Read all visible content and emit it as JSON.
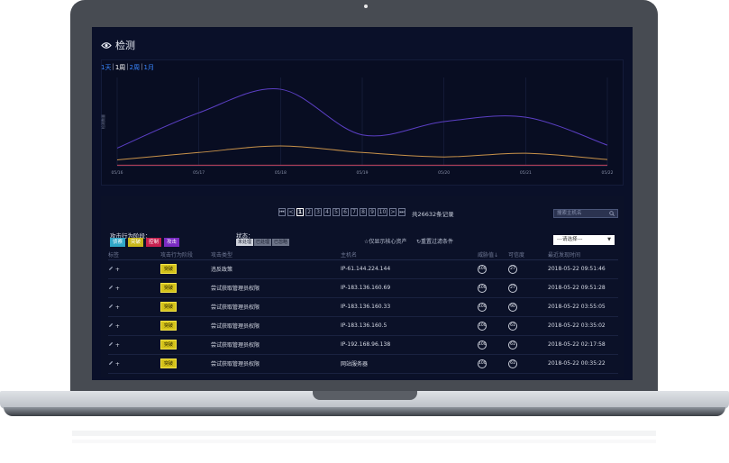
{
  "page": {
    "title": "检测",
    "title_icon": "eye-icon"
  },
  "range_tabs": [
    {
      "label": "1天",
      "active": false
    },
    {
      "label": "1周",
      "active": true
    },
    {
      "label": "2周",
      "active": false
    },
    {
      "label": "1月",
      "active": false
    }
  ],
  "chart_data": {
    "type": "line",
    "x": [
      "05/16",
      "05/17",
      "05/18",
      "05/19",
      "05/20",
      "05/21",
      "05/22"
    ],
    "ylabel": "检测数量",
    "series": [
      {
        "color": "#5b3fc4",
        "values": [
          1200,
          3600,
          5200,
          2100,
          3000,
          3300,
          1400
        ]
      },
      {
        "color": "#c8924a",
        "values": [
          400,
          900,
          1350,
          900,
          600,
          850,
          420
        ]
      },
      {
        "color": "#c0405a",
        "values": [
          40,
          40,
          40,
          40,
          40,
          40,
          40
        ]
      }
    ],
    "ylim": [
      0,
      6000
    ],
    "grid": true
  },
  "pager": {
    "first": "⏮",
    "prev": "<",
    "pages": [
      "1",
      "2",
      "3",
      "4",
      "5",
      "6",
      "7",
      "8",
      "9",
      "10"
    ],
    "active_page": "1",
    "next": ">",
    "last": "⏭",
    "total": "共26632条记录"
  },
  "search": {
    "placeholder": "搜索主机名"
  },
  "filters": {
    "stage_label": "攻击行为阶段：",
    "stages": [
      {
        "label": "侦察",
        "color": "#2fa6c7"
      },
      {
        "label": "突破",
        "color": "#c9b81b"
      },
      {
        "label": "控制",
        "color": "#c7204f"
      },
      {
        "label": "攻击",
        "color": "#7a2cc2"
      }
    ],
    "status_label": "状态：",
    "statuses": [
      "未处理",
      "已处理",
      "已忽略"
    ],
    "core_only": "仅显示核心资产",
    "reset": "重置过滤条件",
    "select_placeholder": "---请选择---"
  },
  "table": {
    "columns": [
      "标签",
      "攻击行为阶段",
      "攻击类型",
      "主机名",
      "威胁值",
      "可信度",
      "最近发现时间"
    ],
    "rows": [
      {
        "stage": "突破",
        "type": "违反政策",
        "host": "IP-61.144.224.144",
        "threat": "100",
        "trust": "27",
        "time": "2018-05-22 09:51:46"
      },
      {
        "stage": "突破",
        "type": "尝试获取管理员权限",
        "host": "IP-183.136.160.69",
        "threat": "100",
        "trust": "27",
        "time": "2018-05-22 09:51:28"
      },
      {
        "stage": "突破",
        "type": "尝试获取管理员权限",
        "host": "IP-183.136.160.33",
        "threat": "100",
        "trust": "90",
        "time": "2018-05-22 03:55:05"
      },
      {
        "stage": "突破",
        "type": "尝试获取管理员权限",
        "host": "IP-183.136.160.5",
        "threat": "100",
        "trust": "61",
        "time": "2018-05-22 03:35:02"
      },
      {
        "stage": "突破",
        "type": "尝试获取管理员权限",
        "host": "IP-192.168.96.138",
        "threat": "100",
        "trust": "61",
        "time": "2018-05-22 02:17:58"
      },
      {
        "stage": "突破",
        "type": "尝试获取管理员权限",
        "host": "网站服务器",
        "threat": "100",
        "trust": "61",
        "time": "2018-05-22 00:35:22"
      }
    ]
  }
}
